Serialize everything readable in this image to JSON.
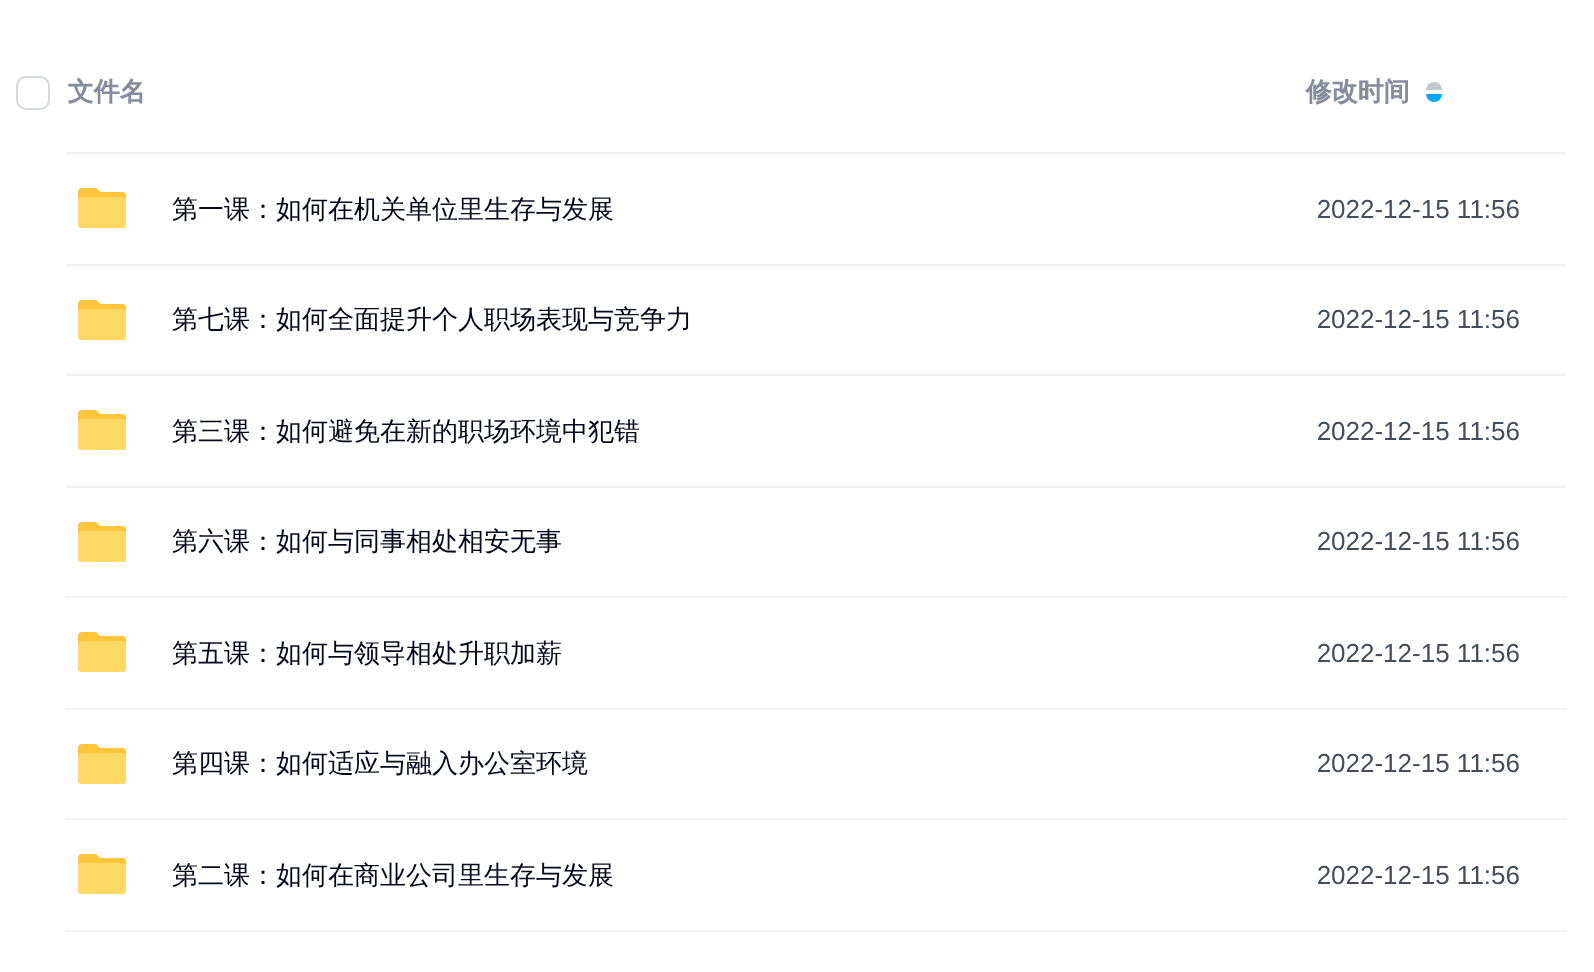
{
  "header": {
    "select_all": {
      "checked": false
    },
    "name_column": "文件名",
    "time_column": "修改时间",
    "sort_descending": true
  },
  "rows": [
    {
      "name": "第一课：如何在机关单位里生存与发展",
      "modified": "2022-12-15 11:56"
    },
    {
      "name": "第七课：如何全面提升个人职场表现与竞争力",
      "modified": "2022-12-15 11:56"
    },
    {
      "name": "第三课：如何避免在新的职场环境中犯错",
      "modified": "2022-12-15 11:56"
    },
    {
      "name": "第六课：如何与同事相处相安无事",
      "modified": "2022-12-15 11:56"
    },
    {
      "name": "第五课：如何与领导相处升职加薪",
      "modified": "2022-12-15 11:56"
    },
    {
      "name": "第四课：如何适应与融入办公室环境",
      "modified": "2022-12-15 11:56"
    },
    {
      "name": "第二课：如何在商业公司里生存与发展",
      "modified": "2022-12-15 11:56"
    }
  ]
}
